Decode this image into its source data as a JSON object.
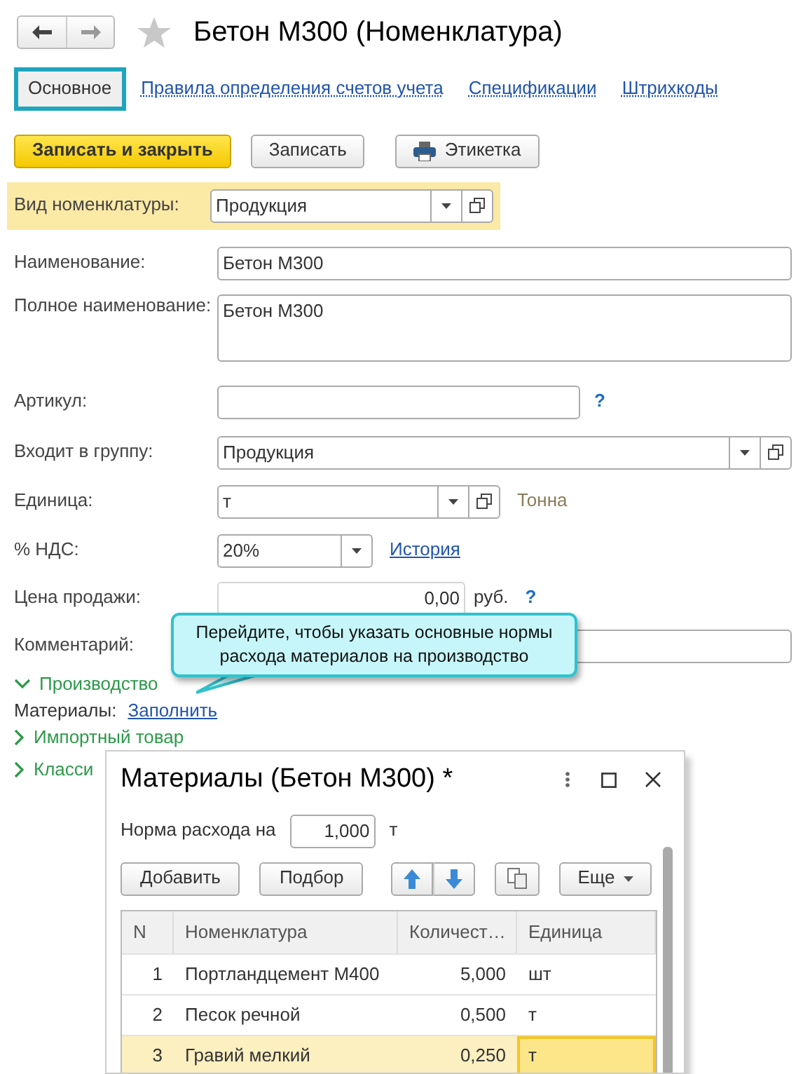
{
  "window": {
    "title": "Бетон М300 (Номенклатура)",
    "favorite": false
  },
  "tabs": [
    {
      "label": "Основное",
      "selected": true
    },
    {
      "label": "Правила определения счетов учета",
      "selected": false
    },
    {
      "label": "Спецификации",
      "selected": false
    },
    {
      "label": "Штрихкоды",
      "selected": false
    }
  ],
  "toolbar": [
    {
      "label": "Записать и закрыть",
      "kind": "primary"
    },
    {
      "label": "Записать",
      "kind": "default"
    },
    {
      "label": "Этикетка",
      "kind": "print"
    }
  ],
  "fields": [
    {
      "label": "Вид номенклатуры:",
      "kind": "select",
      "value": "Продукция",
      "highlighted": true
    },
    {
      "label": "Наименование:",
      "kind": "text",
      "value": "Бетон М300",
      "highlighted": false
    },
    {
      "label": "Полное наименование:",
      "kind": "textarea",
      "value": "Бетон М300",
      "highlighted": false
    },
    {
      "label": "Артикул:",
      "kind": "text",
      "highlighted": false,
      "after": [
        {
          "kind": "help",
          "text": "?"
        }
      ]
    },
    {
      "label": "Входит в группу:",
      "kind": "select",
      "value": "Продукция",
      "highlighted": false
    },
    {
      "label": "Единица:",
      "kind": "select",
      "value": "т",
      "highlighted": false,
      "after": [
        {
          "kind": "note",
          "text": "Тонна"
        }
      ]
    },
    {
      "label": "% НДС:",
      "kind": "combo",
      "value": "20%",
      "highlighted": false,
      "after": [
        {
          "kind": "link",
          "text": "История"
        }
      ]
    },
    {
      "label": "Цена продажи:",
      "kind": "number",
      "value": "0,00",
      "highlighted": false,
      "after": [
        {
          "kind": "text",
          "text": "руб."
        },
        {
          "kind": "help",
          "text": "?"
        }
      ]
    },
    {
      "label": "Комментарий:",
      "kind": "text",
      "highlighted": false
    }
  ],
  "tooltip": {
    "text": "Перейдите, чтобы указать основные нормы расхода материалов на производство"
  },
  "sections": [
    {
      "label": "Производство",
      "expanded": true,
      "row": {
        "label": "Материалы:",
        "link": "Заполнить"
      }
    },
    {
      "label": "Импортный товар",
      "expanded": false
    },
    {
      "label": "Класси",
      "expanded": false
    }
  ],
  "dialog": {
    "title": "Материалы (Бетон М300) *",
    "rate": {
      "label": "Норма расхода на",
      "value": "1,000",
      "unit": "т"
    },
    "buttons": [
      {
        "kind": "text",
        "label": "Добавить"
      },
      {
        "kind": "text",
        "label": "Подбор"
      },
      {
        "kind": "up"
      },
      {
        "kind": "down"
      },
      {
        "kind": "copy"
      },
      {
        "kind": "menu",
        "label": "Еще"
      }
    ],
    "columns": [
      "N",
      "Номенклатура",
      "Количест…",
      "Единица"
    ],
    "rows": [
      {
        "cells": [
          "1",
          "Портландцемент М400",
          "5,000",
          "шт"
        ],
        "selected": false
      },
      {
        "cells": [
          "2",
          "Песок речной",
          "0,500",
          "т"
        ],
        "selected": false
      },
      {
        "cells": [
          "3",
          "Гравий мелкий",
          "0,250",
          "т"
        ],
        "selected": true
      }
    ]
  }
}
